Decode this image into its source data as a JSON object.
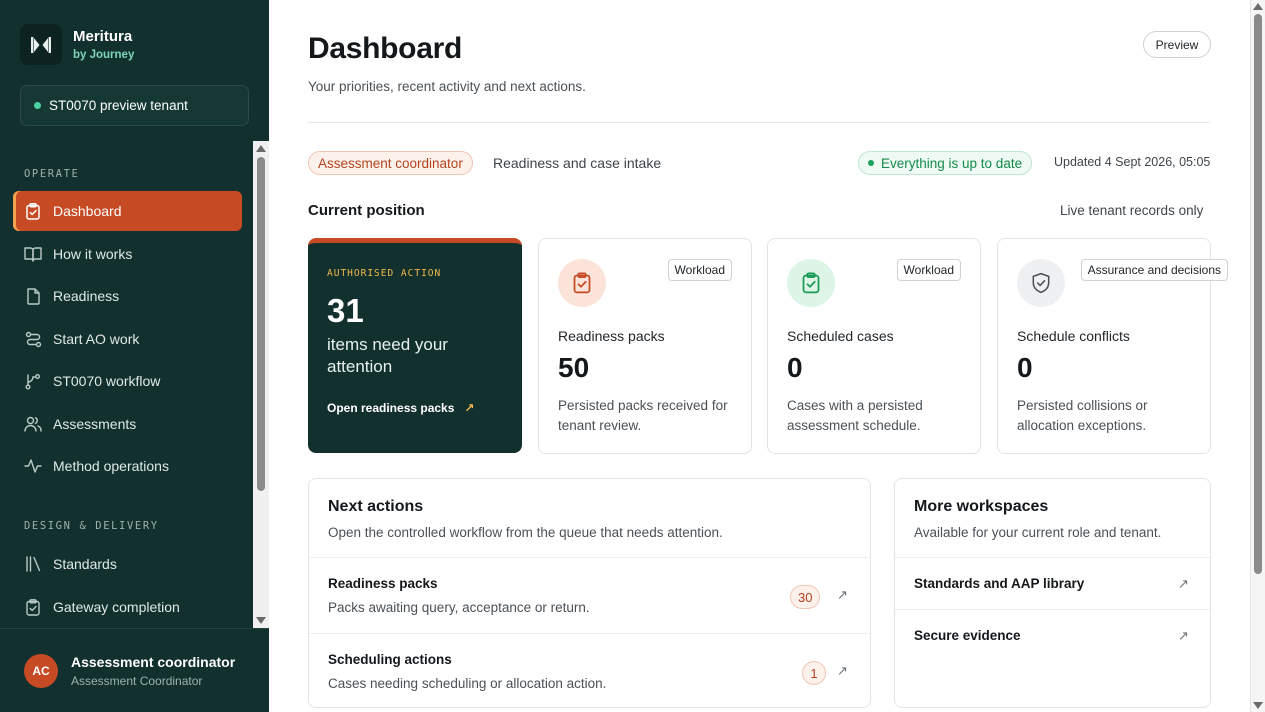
{
  "brand": {
    "name": "Meritura",
    "sub": "by Journey",
    "logo_icon": "meritura-logo-icon"
  },
  "tenant": {
    "label": "ST0070 preview tenant",
    "status_color": "#4cd1a0"
  },
  "sidebar": {
    "sections": [
      {
        "label": "OPERATE"
      },
      {
        "label": "DESIGN & DELIVERY"
      }
    ],
    "items": [
      {
        "label": "Dashboard",
        "icon": "clipboard-check-icon",
        "active": true
      },
      {
        "label": "How it works",
        "icon": "book-open-icon"
      },
      {
        "label": "Readiness",
        "icon": "document-icon"
      },
      {
        "label": "Start AO work",
        "icon": "route-icon"
      },
      {
        "label": "ST0070 workflow",
        "icon": "workflow-icon"
      },
      {
        "label": "Assessments",
        "icon": "users-icon"
      },
      {
        "label": "Method operations",
        "icon": "activity-icon"
      },
      {
        "label": "Standards",
        "icon": "library-icon"
      },
      {
        "label": "Gateway completion",
        "icon": "clipboard-check-icon"
      }
    ]
  },
  "user": {
    "initials": "AC",
    "name": "Assessment coordinator",
    "role": "Assessment Coordinator"
  },
  "header": {
    "title": "Dashboard",
    "subtitle": "Your priorities, recent activity and next actions.",
    "preview_label": "Preview"
  },
  "context": {
    "role_badge": "Assessment coordinator",
    "role_desc": "Readiness and case intake",
    "status": "Everything is up to date",
    "updated": "Updated 4 Sept 2026, 05:05"
  },
  "current_position": {
    "title": "Current position",
    "note": "Live tenant records only",
    "hero": {
      "eyebrow": "AUTHORISED ACTION",
      "count": "31",
      "text": "items need your attention",
      "link": "Open readiness packs",
      "link_icon": "arrow-up-right-icon"
    },
    "cards": [
      {
        "tag": "Workload",
        "title": "Readiness packs",
        "value": "50",
        "desc": "Persisted packs received for tenant review.",
        "icon": "clipboard-check-icon"
      },
      {
        "tag": "Workload",
        "title": "Scheduled cases",
        "value": "0",
        "desc": "Cases with a persisted assessment schedule.",
        "icon": "clipboard-check-icon"
      },
      {
        "tag": "Assurance and decisions",
        "title": "Schedule conflicts",
        "value": "0",
        "desc": "Persisted collisions or allocation exceptions.",
        "icon": "shield-check-icon"
      }
    ]
  },
  "next_actions": {
    "title": "Next actions",
    "subtitle": "Open the controlled workflow from the queue that needs attention.",
    "rows": [
      {
        "title": "Readiness packs",
        "sub": "Packs awaiting query, acceptance or return.",
        "count": "30"
      },
      {
        "title": "Scheduling actions",
        "sub": "Cases needing scheduling or allocation action.",
        "count": "1"
      }
    ]
  },
  "workspaces": {
    "title": "More workspaces",
    "subtitle": "Available for your current role and tenant.",
    "rows": [
      {
        "title": "Standards and AAP library"
      },
      {
        "title": "Secure evidence"
      }
    ]
  },
  "colors": {
    "sidebar_bg": "#12302e",
    "accent": "#c64a23",
    "success": "#138a4b"
  }
}
